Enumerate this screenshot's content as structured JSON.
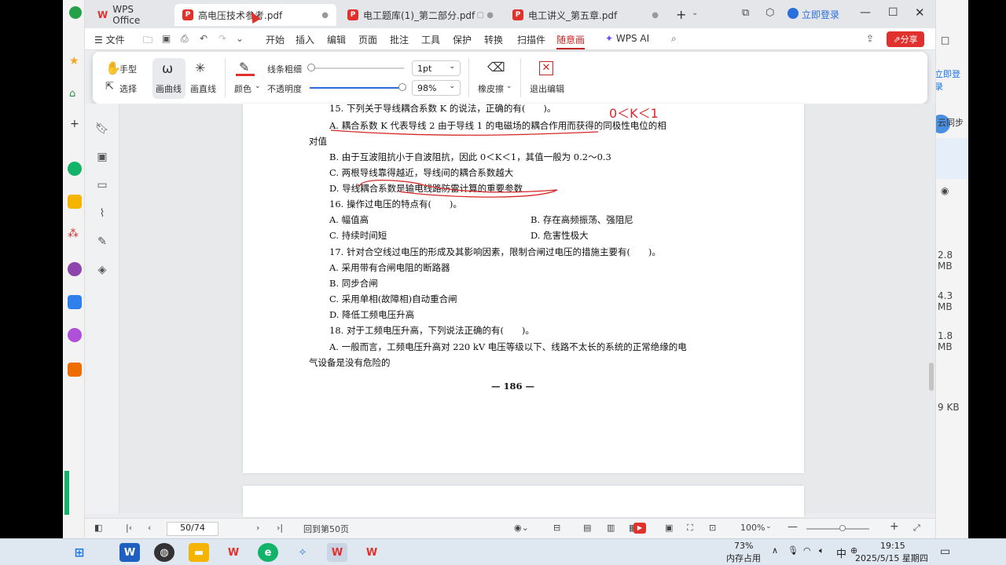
{
  "tabs": [
    {
      "label": "WPS Office"
    },
    {
      "label": "高电压技术参考.pdf"
    },
    {
      "label": "电工题库(1)_第二部分.pdf"
    },
    {
      "label": "电工讲义_第五章.pdf"
    }
  ],
  "window": {
    "login": "立即登录"
  },
  "menu": {
    "file": "文件",
    "items": [
      "开始",
      "插入",
      "编辑",
      "页面",
      "批注",
      "工具",
      "保护",
      "转换",
      "扫描件",
      "随意画"
    ],
    "wps_ai": "WPS AI",
    "share": "分享"
  },
  "ribbon": {
    "hand": "手型",
    "select": "选择",
    "curve": "画曲线",
    "line": "画直线",
    "color": "颜色",
    "thickness_label": "线条粗细",
    "thickness_value": "1pt",
    "opacity_label": "不透明度",
    "opacity_value": "98%",
    "opacity_level": 0.98,
    "eraser": "橡皮擦",
    "exit": "退出编辑"
  },
  "document": {
    "lines": [
      "15. 下列关于导线耦合系数 K 的说法，正确的有(　　)。",
      "A. 耦合系数 K 代表导线 2 由于导线 1 的电磁场的耦合作用而获得的同极性电位的相",
      "对值",
      "B. 由于互波阻抗小于自波阻抗，因此 0＜K＜1，其值一般为 0.2～0.3",
      "C. 两根导线靠得越近，导线间的耦合系数越大",
      "D. 导线耦合系数是输电线路防雷计算的重要参数",
      "16. 操作过电压的特点有(　　)。",
      "A. 幅值高",
      "B. 存在高频振荡、强阻尼",
      "C. 持续时间短",
      "D. 危害性极大",
      "17. 针对合空线过电压的形成及其影响因素，限制合闸过电压的措施主要有(　　)。",
      "A. 采用带有合闸电阻的断路器",
      "B. 同步合闸",
      "C. 采用单相(故障相)自动重合闸",
      "D. 降低工频电压升高",
      "18. 对于工频电压升高，下列说法正确的有(　　)。",
      "A. 一般而言，工频电压升高对 220 kV 电压等级以下、线路不太长的系统的正常绝缘的电",
      "气设备是没有危险的"
    ],
    "page_number": "— 186 —",
    "handwriting": "0＜K＜1"
  },
  "status": {
    "page_input": "50/74",
    "goto": "回到第50页",
    "zoom": "100%"
  },
  "bg_right": {
    "login": "立即登录",
    "sync": "云同步",
    "sizes": [
      "2.8 MB",
      "4.3 MB",
      "1.8 MB",
      "9 KB"
    ]
  },
  "taskbar": {
    "mem_pct": "73%",
    "mem_label": "内存占用",
    "ime": "中",
    "time": "19:15",
    "date": "2025/5/15 星期四"
  }
}
